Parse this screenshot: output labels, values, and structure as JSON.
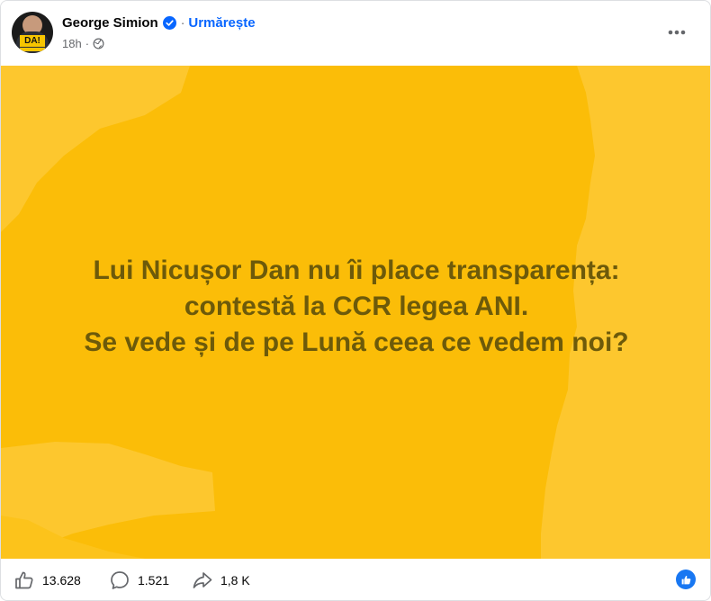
{
  "post": {
    "author": "George Simion",
    "follow_label": "Urmărește",
    "separator": "·",
    "time": "18h",
    "avatar_badge_text": "DA!"
  },
  "image": {
    "lines": [
      "Lui Nicușor Dan nu îi place transparența:",
      "contestă la CCR legea ANI.",
      "Se vede și de pe Lună ceea ce vedem noi?"
    ]
  },
  "stats": {
    "likes": "13.628",
    "comments": "1.521",
    "shares": "1,8 K"
  },
  "colors": {
    "accent": "#0866ff",
    "image_bg": "#fbbd08",
    "image_bg_light": "#fdc72e",
    "headline": "#6d5a0a"
  }
}
